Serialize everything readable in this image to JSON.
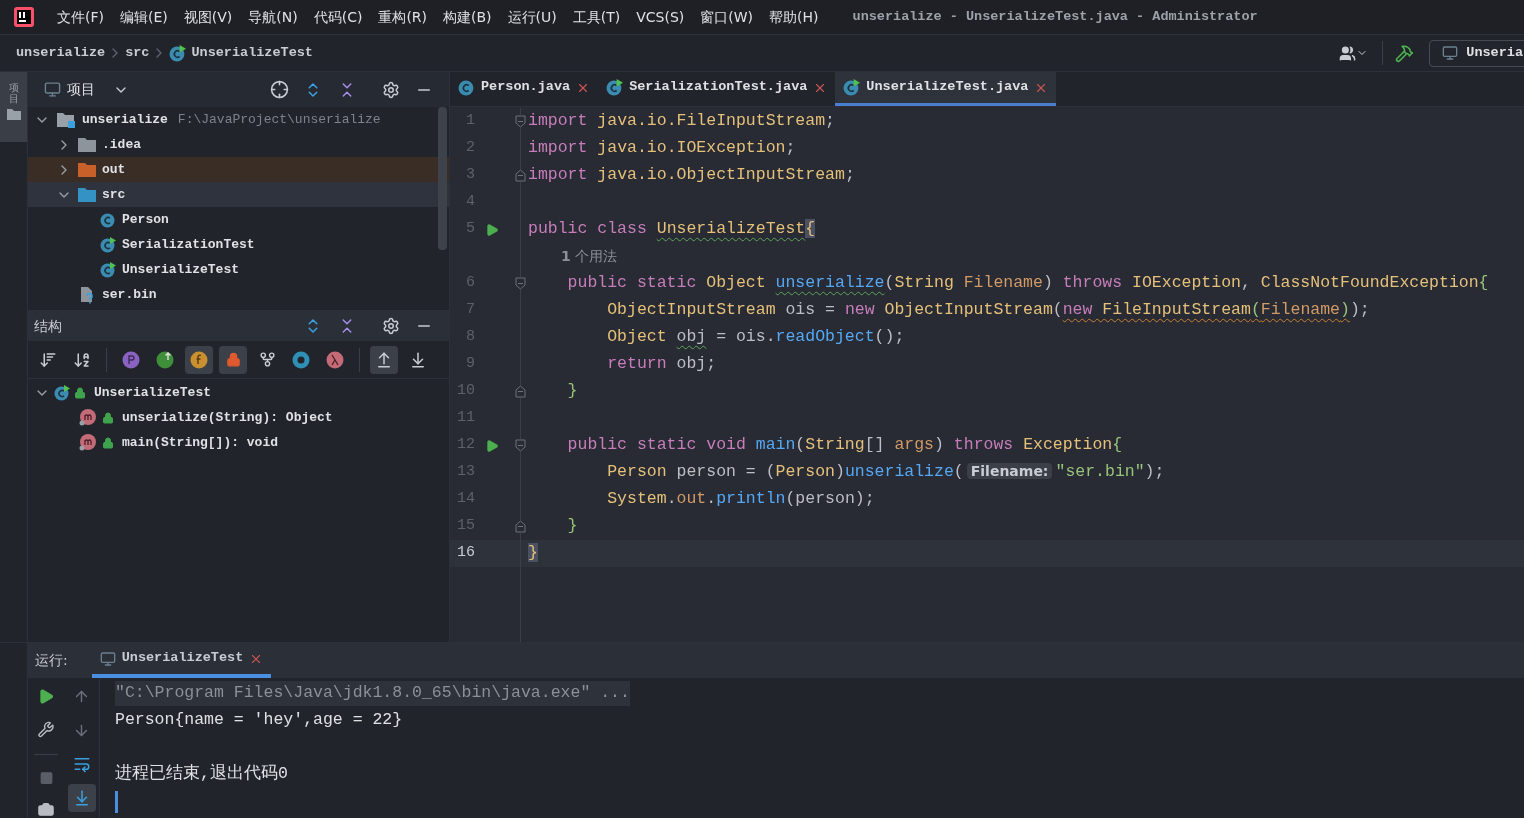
{
  "menu": [
    "文件(F)",
    "编辑(E)",
    "视图(V)",
    "导航(N)",
    "代码(C)",
    "重构(R)",
    "构建(B)",
    "运行(U)",
    "工具(T)",
    "VCS(S)",
    "窗口(W)",
    "帮助(H)"
  ],
  "window_title": "unserialize - UnserializeTest.java - Administrator",
  "breadcrumb": [
    {
      "label": "unserialize",
      "kind": "module"
    },
    {
      "label": "src",
      "kind": "folder"
    },
    {
      "label": "UnserializeTest",
      "kind": "runnable_class"
    }
  ],
  "run_config": "Unseria",
  "side_tab": "项目",
  "project_panel": {
    "title": "项目",
    "tree": [
      {
        "name": "unserialize",
        "path": "F:\\JavaProject\\unserialize",
        "kind": "module",
        "expanded": true,
        "selected": false,
        "children": [
          {
            "name": ".idea",
            "kind": "folder",
            "expanded": false,
            "selected": false
          },
          {
            "name": "out",
            "kind": "excluded_folder",
            "expanded": false,
            "selected": false
          },
          {
            "name": "src",
            "kind": "source_folder",
            "expanded": true,
            "selected": true,
            "children": [
              {
                "name": "Person",
                "kind": "class",
                "selected": false
              },
              {
                "name": "SerializationTest",
                "kind": "runnable_class",
                "selected": false
              },
              {
                "name": "UnserializeTest",
                "kind": "runnable_class",
                "selected": false
              }
            ]
          },
          {
            "name": "ser.bin",
            "kind": "unknown_file",
            "selected": false
          }
        ]
      }
    ]
  },
  "structure_panel": {
    "title": "结构",
    "tools": [
      {
        "kind": "sort_visibility",
        "on": false
      },
      {
        "kind": "sort_alpha",
        "on": false
      },
      {
        "kind": "separator"
      },
      {
        "kind": "property",
        "on": false
      },
      {
        "kind": "inherited",
        "on": false
      },
      {
        "kind": "field",
        "on": true
      },
      {
        "kind": "nonpublic",
        "on": true
      },
      {
        "kind": "anonymous",
        "on": false
      },
      {
        "kind": "lambda_ring",
        "on": false
      },
      {
        "kind": "lambda",
        "on": false
      },
      {
        "kind": "separator"
      },
      {
        "kind": "scroll_to_source",
        "on": true
      },
      {
        "kind": "scroll_from_source",
        "on": false
      }
    ],
    "tree": [
      {
        "name": "UnserializeTest",
        "kind": "runnable_class",
        "expanded": true,
        "children": [
          {
            "name": "unserialize(String): Object",
            "kind": "method"
          },
          {
            "name": "main(String[]): void",
            "kind": "method"
          }
        ]
      }
    ]
  },
  "editor_tabs": [
    {
      "label": "Person.java",
      "kind": "class",
      "selected": false
    },
    {
      "label": "SerializationTest.java",
      "kind": "runnable_class",
      "selected": false
    },
    {
      "label": "UnserializeTest.java",
      "kind": "runnable_class",
      "selected": true
    }
  ],
  "code_lines": [
    {
      "kind": "code",
      "number": "1",
      "fold_start": true,
      "fold_end": false,
      "run": false,
      "current": false,
      "tokens": [
        {
          "text": "import",
          "kind": "keyword"
        },
        {
          "text": " java.io.FileInputStream",
          "kind": "type"
        },
        {
          "text": ";",
          "kind": "plain"
        }
      ]
    },
    {
      "kind": "code",
      "number": "2",
      "fold_start": false,
      "fold_end": false,
      "run": false,
      "current": false,
      "tokens": [
        {
          "text": "import",
          "kind": "keyword"
        },
        {
          "text": " java.io.IOException",
          "kind": "type"
        },
        {
          "text": ";",
          "kind": "plain"
        }
      ]
    },
    {
      "kind": "code",
      "number": "3",
      "fold_start": false,
      "fold_end": true,
      "run": false,
      "current": false,
      "tokens": [
        {
          "text": "import",
          "kind": "keyword"
        },
        {
          "text": " java.io.ObjectInputStream",
          "kind": "type"
        },
        {
          "text": ";",
          "kind": "plain"
        }
      ]
    },
    {
      "kind": "code",
      "number": "4",
      "fold_start": false,
      "fold_end": false,
      "run": false,
      "current": false
    },
    {
      "kind": "code",
      "number": "5",
      "fold_start": false,
      "fold_end": false,
      "run": true,
      "current": false,
      "tokens": [
        {
          "text": "public class ",
          "kind": "keyword"
        },
        {
          "text": "UnserializeTest",
          "kind": "type",
          "typo": true
        },
        {
          "text": "{",
          "kind": "brace_match"
        }
      ]
    },
    {
      "kind": "usage_hint",
      "text": "**1** 个用法"
    },
    {
      "kind": "code",
      "number": "6",
      "fold_start": true,
      "fold_end": false,
      "run": false,
      "current": false,
      "tokens": [
        {
          "text": "    public static ",
          "kind": "keyword"
        },
        {
          "text": "Object ",
          "kind": "type"
        },
        {
          "text": "unserialize",
          "kind": "method",
          "typo": true
        },
        {
          "text": "(",
          "kind": "plain"
        },
        {
          "text": "String ",
          "kind": "type"
        },
        {
          "text": "Filename",
          "kind": "param"
        },
        {
          "text": ") ",
          "kind": "plain"
        },
        {
          "text": "throws ",
          "kind": "keyword"
        },
        {
          "text": "IOException",
          "kind": "type"
        },
        {
          "text": ", ",
          "kind": "plain"
        },
        {
          "text": "ClassNotFoundException",
          "kind": "type"
        },
        {
          "text": "{",
          "kind": "brace"
        }
      ]
    },
    {
      "kind": "code",
      "number": "7",
      "fold_start": false,
      "fold_end": false,
      "run": false,
      "current": false,
      "tokens": [
        {
          "text": "        ObjectInputStream ",
          "kind": "type"
        },
        {
          "text": "ois = ",
          "kind": "plain"
        },
        {
          "text": "new ",
          "kind": "keyword"
        },
        {
          "text": "ObjectInputStream",
          "kind": "type"
        },
        {
          "text": "(",
          "kind": "plain"
        },
        {
          "text": "new",
          "kind": "keyword",
          "warning": true
        },
        {
          "text": " FileInputStream",
          "kind": "type",
          "warning": true
        },
        {
          "text": "(",
          "kind": "brace",
          "warning": true
        },
        {
          "text": "Filename",
          "kind": "param",
          "warning": true
        },
        {
          "text": ")",
          "kind": "brace",
          "warning": true
        },
        {
          "text": ");",
          "kind": "plain"
        }
      ]
    },
    {
      "kind": "code",
      "number": "8",
      "fold_start": false,
      "fold_end": false,
      "run": false,
      "current": false,
      "tokens": [
        {
          "text": "        Object ",
          "kind": "type"
        },
        {
          "text": "obj",
          "kind": "plain",
          "typo": true
        },
        {
          "text": " = ois.",
          "kind": "plain"
        },
        {
          "text": "readObject",
          "kind": "method"
        },
        {
          "text": "();",
          "kind": "plain"
        }
      ]
    },
    {
      "kind": "code",
      "number": "9",
      "fold_start": false,
      "fold_end": false,
      "run": false,
      "current": false,
      "tokens": [
        {
          "text": "        return ",
          "kind": "keyword"
        },
        {
          "text": "obj;",
          "kind": "plain"
        }
      ]
    },
    {
      "kind": "code",
      "number": "10",
      "fold_start": false,
      "fold_end": true,
      "run": false,
      "current": false,
      "tokens": [
        {
          "text": "    }",
          "kind": "brace"
        }
      ]
    },
    {
      "kind": "code",
      "number": "11",
      "fold_start": false,
      "fold_end": false,
      "run": false,
      "current": false
    },
    {
      "kind": "code",
      "number": "12",
      "fold_start": true,
      "fold_end": false,
      "run": true,
      "current": false,
      "tokens": [
        {
          "text": "    public static void ",
          "kind": "keyword"
        },
        {
          "text": "main",
          "kind": "method"
        },
        {
          "text": "(",
          "kind": "plain"
        },
        {
          "text": "String",
          "kind": "type"
        },
        {
          "text": "[] ",
          "kind": "plain"
        },
        {
          "text": "args",
          "kind": "param"
        },
        {
          "text": ") ",
          "kind": "plain"
        },
        {
          "text": "throws ",
          "kind": "keyword"
        },
        {
          "text": "Exception",
          "kind": "type"
        },
        {
          "text": "{",
          "kind": "brace"
        }
      ]
    },
    {
      "kind": "code",
      "number": "13",
      "fold_start": false,
      "fold_end": false,
      "run": false,
      "current": false,
      "tokens": [
        {
          "text": "        Person ",
          "kind": "type"
        },
        {
          "text": "person = (",
          "kind": "plain"
        },
        {
          "text": "Person",
          "kind": "type"
        },
        {
          "text": ")",
          "kind": "plain"
        },
        {
          "text": "unserialize",
          "kind": "method"
        },
        {
          "text": "(",
          "kind": "plain"
        },
        {
          "text": "Filename:",
          "kind": "inlay"
        },
        {
          "text": "\"ser.bin\"",
          "kind": "string"
        },
        {
          "text": ");",
          "kind": "plain"
        }
      ]
    },
    {
      "kind": "code",
      "number": "14",
      "fold_start": false,
      "fold_end": false,
      "run": false,
      "current": false,
      "tokens": [
        {
          "text": "        System",
          "kind": "type"
        },
        {
          "text": ".",
          "kind": "plain"
        },
        {
          "text": "out",
          "kind": "field"
        },
        {
          "text": ".",
          "kind": "plain"
        },
        {
          "text": "println",
          "kind": "method"
        },
        {
          "text": "(person);",
          "kind": "plain"
        }
      ]
    },
    {
      "kind": "code",
      "number": "15",
      "fold_start": false,
      "fold_end": true,
      "run": false,
      "current": false,
      "tokens": [
        {
          "text": "    }",
          "kind": "brace"
        }
      ]
    },
    {
      "kind": "code",
      "number": "16",
      "fold_start": false,
      "fold_end": false,
      "run": false,
      "current": true,
      "tokens": [
        {
          "text": "}",
          "kind": "brace_match"
        }
      ]
    }
  ],
  "run_panel": {
    "label": "运行:",
    "tabs": [
      {
        "label": "UnserializeTest",
        "selected": true
      }
    ],
    "tools": [
      {
        "kind": "rerun",
        "disabled": false
      },
      {
        "kind": "settings",
        "disabled": false
      },
      {
        "kind": "separator"
      },
      {
        "kind": "stop",
        "disabled": true
      },
      {
        "kind": "screenshot",
        "disabled": false
      }
    ],
    "console_tools": [
      {
        "kind": "up",
        "on": false
      },
      {
        "kind": "down",
        "on": false
      },
      {
        "kind": "soft_wrap",
        "on": false
      },
      {
        "kind": "scroll_end",
        "on": true
      }
    ],
    "console": [
      {
        "kind": "command",
        "text": "\"C:\\Program Files\\Java\\jdk1.8.0_65\\bin\\java.exe\" ..."
      },
      {
        "kind": "output",
        "text": "Person{name = 'hey',age = 22}"
      },
      {
        "kind": "blank"
      },
      {
        "kind": "output",
        "text": "进程已结束,退出代码0"
      },
      {
        "kind": "caret"
      }
    ]
  }
}
